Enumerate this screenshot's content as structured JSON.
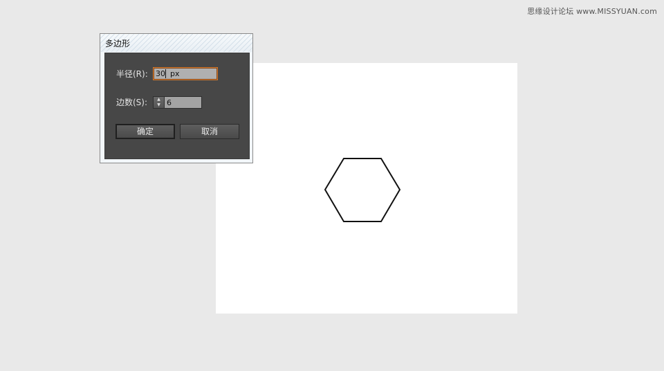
{
  "watermark": "思缘设计论坛 www.MISSYUAN.com",
  "dialog": {
    "title": "多边形",
    "radius_label": "半径(R):",
    "radius_value": "30",
    "radius_unit": "px",
    "sides_label": "边数(S):",
    "sides_value": "6",
    "ok_label": "确定",
    "cancel_label": "取消"
  },
  "canvas": {
    "shape": "hexagon",
    "fill": "#ffffff",
    "stroke": "#111111"
  },
  "colors": {
    "background": "#e9e9e9",
    "dialog_body": "#474747",
    "input_focus_border": "#d47a2e"
  },
  "icons": {
    "stepper_up": "arrow-up-icon",
    "stepper_down": "arrow-down-icon"
  }
}
